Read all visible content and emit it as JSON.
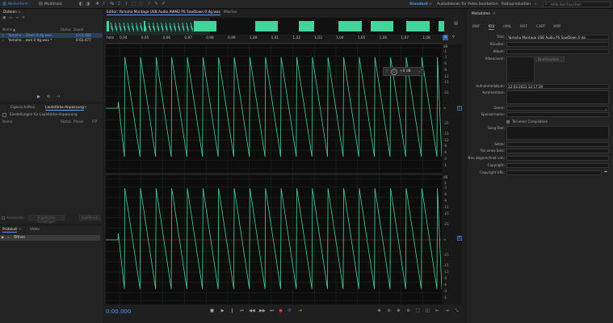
{
  "topbar": {
    "view_waveform": "Wellenform",
    "view_multitrack": "Multitrack",
    "workspace_active": "Standard",
    "workspace_video": "Audiodateien für Video bearbeiten",
    "workspace_radio": "Radioproduktion",
    "search_placeholder": "Hilfe durchsuchen"
  },
  "files": {
    "title": "Dateien",
    "col_name": "Name",
    "col_status": "Status",
    "col_duration": "Dauer",
    "items": [
      {
        "name": "Yamaha ...Down 0 dg.wav",
        "duration": "0:03.488",
        "selected": true
      },
      {
        "name": "Yamaha ...own 0 dg.wav *",
        "duration": "0:03.477",
        "selected": false
      }
    ]
  },
  "effects": {
    "tab_properties": "Eigenschaften",
    "tab_loudness": "Lautstärke-Anpassung",
    "settings_label": "Einstellungen für Lautstärke-Anpassung",
    "col_name": "Name",
    "col_status": "Status",
    "col_phase": "Phase",
    "col_itp": "ITP",
    "checkbox_label": "Anwenden",
    "btn_analyze": "Ergebnisse hinzufügen",
    "btn_execute": "Ausführen"
  },
  "history": {
    "tab_protocol": "Protokoll",
    "tab_video": "Video",
    "item": "Öffnen"
  },
  "editor": {
    "tab_title": "Editor: Yamaha Montage USB Audio AWM2 PS SawDown 0 dg.wav",
    "tab_mixer": "Mischer",
    "ruler_unit": "hms",
    "ruler_ticks": [
      "0,94",
      "0,95",
      "0,96",
      "0,97",
      "0,98",
      "0,99",
      "1,00",
      "1,01",
      "1,02",
      "1,03",
      "1,04",
      "1,05",
      "1,06",
      "1,07",
      "1,08"
    ],
    "hud_value": "+0 dB",
    "db_labels_top": [
      "dB",
      "-1",
      "-3",
      "-6",
      "-9",
      "-12",
      "-15",
      "-21",
      "∞",
      "-21",
      "-15",
      "-12",
      "-9",
      "-6",
      "-3",
      "-1"
    ],
    "db_labels_bottom": [
      "dB",
      "-1",
      "-3",
      "-6",
      "-9",
      "-12",
      "-15",
      "-21",
      "∞",
      "-21",
      "-15",
      "-12",
      "-9",
      "-6",
      "-3",
      "-1"
    ],
    "channel_left": "L",
    "channel_right": "R",
    "timecode": "0:00.000"
  },
  "metadata": {
    "title": "Metadaten",
    "tabs": [
      "BWF",
      "ID3",
      "iXML",
      "RIFF",
      "CART",
      "XMP"
    ],
    "active_tab": "ID3",
    "fields": {
      "title_label": "Titel:",
      "title_value": "Yamaha Montage USB Audio PS SawDown 0 dg",
      "artist_label": "Künstler:",
      "album_label": "Album:",
      "cover_label": "Albencover:",
      "cover_button": "Durchsuchen...",
      "date_label": "Aufnahmedatum:",
      "date_value": "12.03.2023 12:17:39",
      "comment_label": "Kommentare:",
      "genre_label": "Genre:",
      "composer_label": "Sponsorname:",
      "compilation_label": "Teil einer Compilation",
      "song_label": "Song-Text:",
      "sets_label": "Setze:",
      "part_label": "Teil eines Sets:",
      "encoder_label": "Neu abgerechnet von:",
      "copyright_label": "Copyright:",
      "copyright_url_label": "Copyright URL:"
    }
  },
  "colors": {
    "waveform": "#43d49a",
    "accent": "#3d8ef0",
    "background": "#0d0d0d"
  }
}
